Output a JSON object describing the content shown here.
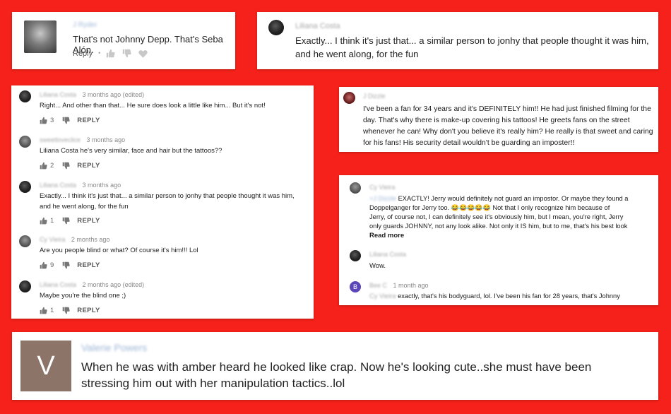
{
  "card1": {
    "author": "J Ryder",
    "text": "That's not Johnny Depp. That's Seba Alón.",
    "reply": "Reply",
    "dot": "•"
  },
  "card2": {
    "author": "Liliana Costa",
    "line1": "Exactly... I think it's just that... a similar person to jonhy that people thought it was him,",
    "line2": "and he went along, for the fun"
  },
  "thread": {
    "comments": [
      {
        "author": "Liliana Costa",
        "time": "3 months ago (edited)",
        "line1": "Right... And other than that... He sure does look a little like him... But it's not!",
        "line2": "",
        "likes": "3",
        "reply": "REPLY"
      },
      {
        "author": "sweetloveclice",
        "time": "3 months ago",
        "line1": "Liliana Costa he's very similar, face and hair but the tattoos??",
        "line2": "",
        "likes": "2",
        "reply": "REPLY"
      },
      {
        "author": "Liliana Costa",
        "time": "3 months ago",
        "line1": "Exactly... I think it's just that... a similar person to jonhy that people thought it was him,",
        "line2": "and he went along, for the fun",
        "likes": "1",
        "reply": "REPLY"
      },
      {
        "author": "Cy Vieira",
        "time": "2 months ago",
        "line1": "Are you people blind or what? Of course it's him!!! Lol",
        "line2": "",
        "likes": "9",
        "reply": "REPLY"
      },
      {
        "author": "Liliana Costa",
        "time": "2 months ago (edited)",
        "line1": "Maybe you're the blind one ;)",
        "line2": "",
        "likes": "1",
        "reply": "REPLY"
      }
    ]
  },
  "card4": {
    "author": "J Dizzle",
    "lines": [
      "I've been a fan for 34 years and it's DEFINITELY him!! He had just finished filming for the",
      "day. That's why there is make-up covering his tattoos! He greets fans on the street",
      "whenever he can! Why don't you believe it's really him? He really is that sweet and caring",
      "for his fans! His security detail wouldn't be guarding an imposter!!"
    ]
  },
  "card5": {
    "c1": {
      "author": "Cy Vieira",
      "mention": "+J Dizzle",
      "lines": [
        "EXACTLY! Jerry would definitely not guard an impostor. Or maybe they found a",
        "Doppelganger for Jerry too.",
        "Not that I only recognize him because of",
        "Jerry, of course not, I can definitely see it's obviously him, but I mean, you're right, Jerry",
        "only guards JOHNNY, not any look alike. Not only it IS him, but to me, that's his best look"
      ],
      "emojis": "😂😂😂😂😂",
      "read_more": "Read more"
    },
    "c2": {
      "author": "Liliana Costa",
      "text": "Wow."
    },
    "c3": {
      "avatar_letter": "B",
      "author": "Bee C",
      "time": "1 month ago",
      "mention": "Cy Vieira",
      "text": "exactly, that's his bodyguard, lol. I've been his fan for 28 years, that's Johnny"
    }
  },
  "card6": {
    "avatar_letter": "V",
    "author": "Valerie Powers",
    "line1": "When he was with amber heard he looked like crap. Now he's looking cute..she must have been",
    "line2": "stressing him out with her manipulation tactics..lol"
  },
  "colors": {
    "background": "#f5211a",
    "avatar_v": "#8c7468",
    "avatar_b": "#5c45b8"
  },
  "icons": [
    "thumbs-up-icon",
    "thumbs-down-icon",
    "heart-icon"
  ]
}
